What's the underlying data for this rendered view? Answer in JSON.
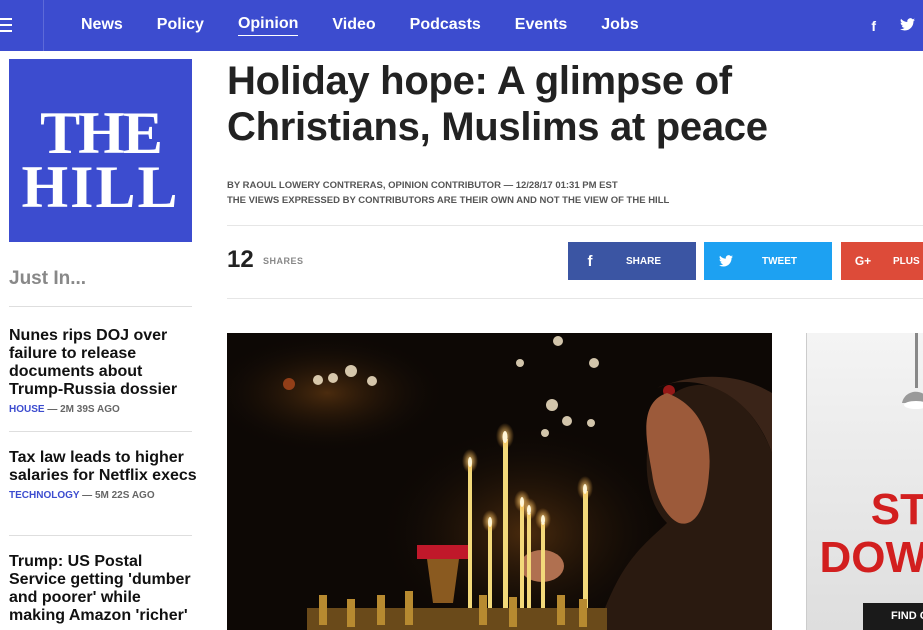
{
  "nav": {
    "items": [
      "News",
      "Policy",
      "Opinion",
      "Video",
      "Podcasts",
      "Events",
      "Jobs"
    ],
    "active": "Opinion",
    "social": [
      {
        "icon": "facebook-icon",
        "glyph": "f"
      },
      {
        "icon": "twitter-icon",
        "glyph": "t"
      }
    ]
  },
  "logo": {
    "line1": "THE",
    "line2": "HILL"
  },
  "sidebar": {
    "heading": "Just In...",
    "items": [
      {
        "title": "Nunes rips DOJ over failure to release documents about Trump-Russia dossier",
        "category": "HOUSE",
        "age": "— 2M 39S AGO"
      },
      {
        "title": "Tax law leads to higher salaries for Netflix execs",
        "category": "TECHNOLOGY",
        "age": "— 5M 22S AGO"
      },
      {
        "title": "Trump: US Postal Service getting 'dumber and poorer' while making Amazon 'richer'",
        "category": "",
        "age": ""
      }
    ]
  },
  "article": {
    "headline": "Holiday hope: A glimpse of Christians, Muslims at peace",
    "byline": "BY RAOUL LOWERY CONTRERAS, OPINION CONTRIBUTOR — 12/28/17 01:31 PM EST",
    "disclaimer": "THE VIEWS EXPRESSED BY CONTRIBUTORS ARE THEIR OWN AND NOT THE VIEW OF THE HILL",
    "shares": {
      "count": "12",
      "label": "SHARES"
    },
    "buttons": [
      {
        "name": "facebook",
        "label": "SHARE",
        "glyph": "f",
        "color": "#3b55a3"
      },
      {
        "name": "twitter",
        "label": "TWEET",
        "glyph": "🐦",
        "color": "#1da1f2"
      },
      {
        "name": "googleplus",
        "label": "PLUS",
        "glyph": "G+",
        "color": "#dd4b39"
      }
    ]
  },
  "ad": {
    "line1": "ST",
    "line2": "DOW",
    "button": "FIND O"
  },
  "colors": {
    "brand": "#3c4ccf",
    "category": "#3c4ccf"
  }
}
